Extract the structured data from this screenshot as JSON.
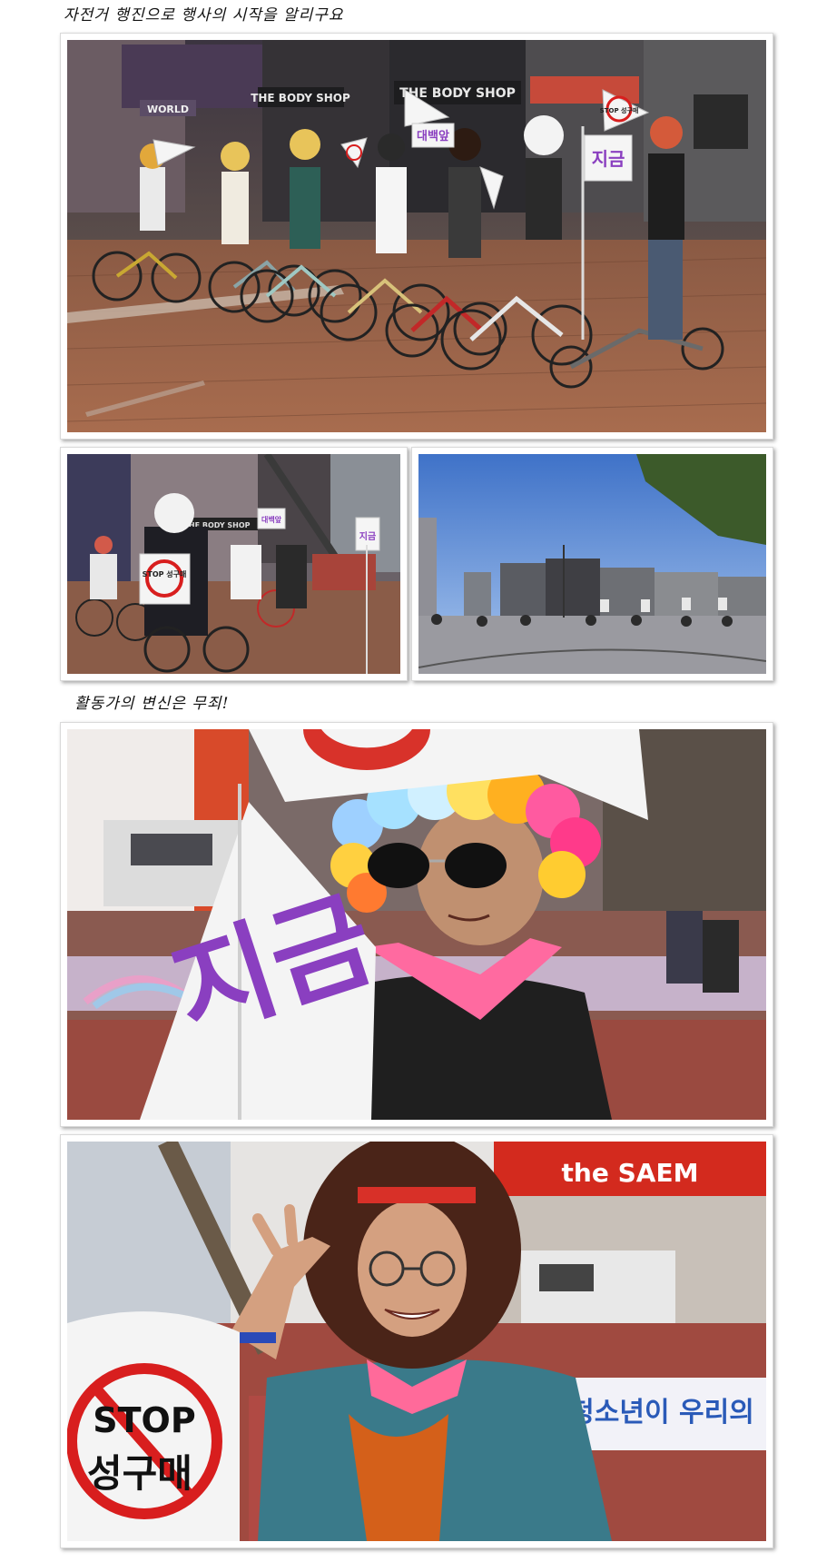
{
  "captions": {
    "top": "자전거 행진으로 행사의 시작을 알리구요",
    "middle": "활동가의 변신은 무죄!"
  },
  "photo1": {
    "store_signs": [
      "THE BODY SHOP",
      "THE BODY SHOP",
      "WORLD"
    ],
    "flags": [
      "STOP 성구매",
      "대백앞",
      "지금"
    ]
  },
  "photo2": {
    "flags": [
      "STOP 성구매",
      "대백앞",
      "지금"
    ],
    "store_sign": "THE BODY SHOP"
  },
  "photo4": {
    "flag_text": "지금"
  },
  "photo5": {
    "store_sign": "the SAEM",
    "sign_stop": "STOP",
    "sign_korean": "성구매",
    "banner": "청소년이 우리의"
  },
  "colors": {
    "flag_purple": "#8a3fc0",
    "stop_red": "#d81e1e",
    "saem_red": "#d32a1e"
  }
}
